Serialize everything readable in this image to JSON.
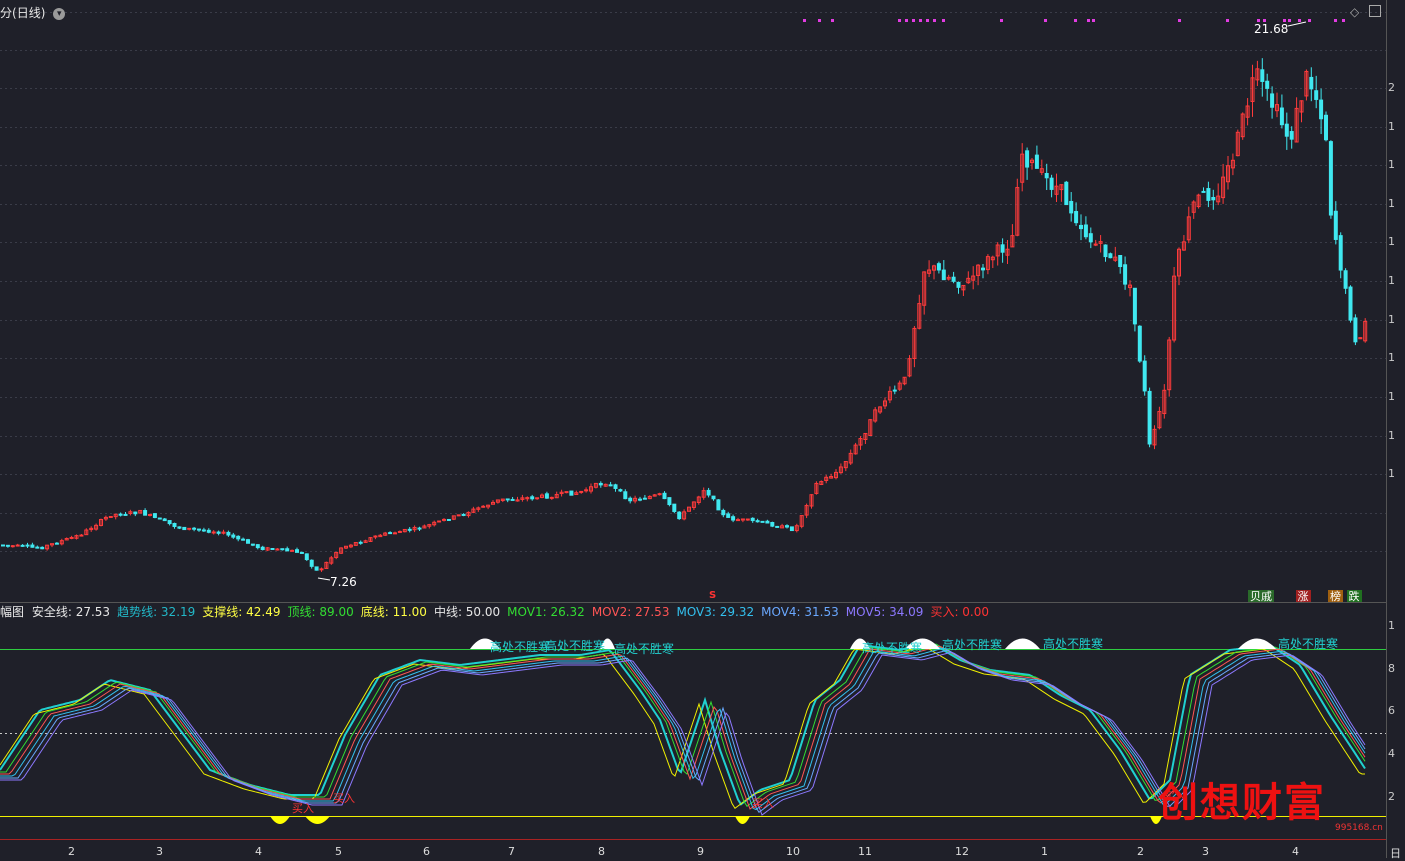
{
  "main": {
    "title_partial": "分",
    "period": "(日线)",
    "high_label": "21.68",
    "low_label": "7.26",
    "marker_s": "S",
    "legend": {
      "a": "贝戚",
      "b": "涨",
      "c": "榜",
      "d": "跌"
    }
  },
  "y_ticks_main": [
    "2",
    "1",
    "1",
    "1",
    "1",
    "1",
    "1",
    "1",
    "1",
    "1",
    "1"
  ],
  "y_ticks_sub": [
    "1",
    "8",
    "6",
    "4",
    "2"
  ],
  "x_ticks": [
    "2",
    "3",
    "4",
    "5",
    "6",
    "7",
    "8",
    "9",
    "10",
    "11",
    "12",
    "1",
    "2",
    "3",
    "4"
  ],
  "x_tick_end": "日",
  "indicator": {
    "name": "幅图",
    "items": [
      {
        "label": "安全线:",
        "value": "27.53",
        "color": "#e6e6e6"
      },
      {
        "label": "趋势线:",
        "value": "32.19",
        "color": "#22b8c8"
      },
      {
        "label": "支撑线:",
        "value": "42.49",
        "color": "#ffff44"
      },
      {
        "label": "顶线:",
        "value": "89.00",
        "color": "#33dd33"
      },
      {
        "label": "底线:",
        "value": "11.00",
        "color": "#ffff44"
      },
      {
        "label": "中线:",
        "value": "50.00",
        "color": "#e6e6e6"
      },
      {
        "label": "MOV1:",
        "value": "26.32",
        "color": "#33dd33"
      },
      {
        "label": "MOV2:",
        "value": "27.53",
        "color": "#ff5555"
      },
      {
        "label": "MOV3:",
        "value": "29.32",
        "color": "#33c0ee"
      },
      {
        "label": "MOV4:",
        "value": "31.53",
        "color": "#6aa8ff"
      },
      {
        "label": "MOV5:",
        "value": "34.09",
        "color": "#8c78ff"
      },
      {
        "label": "买入:",
        "value": "0.00",
        "color": "#ff3333"
      }
    ],
    "peak_text": "高处不胜寒",
    "buy_text": "买入"
  },
  "watermark": {
    "text": "创想财富",
    "url": "995168.cn"
  },
  "colors": {
    "up": "#ff3b3b",
    "down": "#40e8f0",
    "bg": "#1f2029"
  }
}
